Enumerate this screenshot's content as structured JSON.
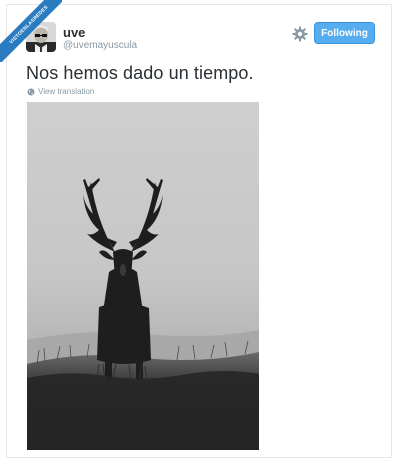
{
  "watermark": {
    "text": "VISTOENLASREDES"
  },
  "user": {
    "name": "uve",
    "handle": "@uvemayuscula"
  },
  "actions": {
    "settings_icon": "gear-icon",
    "follow_label": "Following"
  },
  "tweet": {
    "text": "Nos hemos dado un tiempo.",
    "translate_label": "View translation",
    "translate_icon": "globe-icon",
    "photo": "black-and-white photo of a stag with large antlers standing in a misty grass field"
  },
  "colors": {
    "follow_button": "#55acee",
    "text": "#292f33",
    "secondary_text": "#8899a6"
  }
}
